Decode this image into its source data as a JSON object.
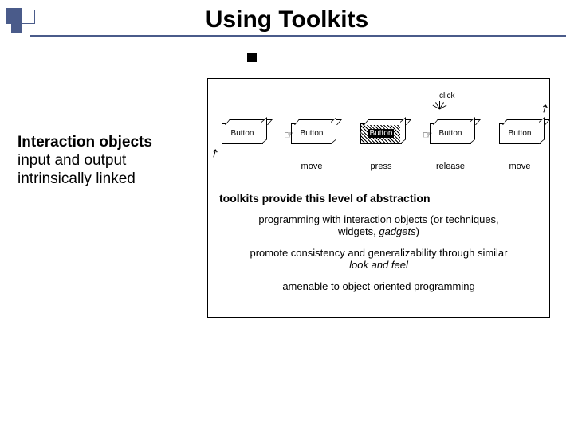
{
  "title": "Using Toolkits",
  "left": {
    "heading": "Interaction objects",
    "line1": "input and output",
    "line2": "intrinsically linked"
  },
  "buttons": {
    "label": "Button",
    "click": "click",
    "phases": [
      "",
      "move",
      "press",
      "release",
      "move"
    ]
  },
  "abstraction": {
    "heading": "toolkits provide this level of abstraction",
    "p1_a": "programming with interaction objects (or techniques, widgets, ",
    "p1_em": "gadgets",
    "p1_b": ")",
    "p2_a": "promote consistency and generalizability through similar ",
    "p2_em": "look and feel",
    "p3": "amenable to object-oriented programming"
  }
}
